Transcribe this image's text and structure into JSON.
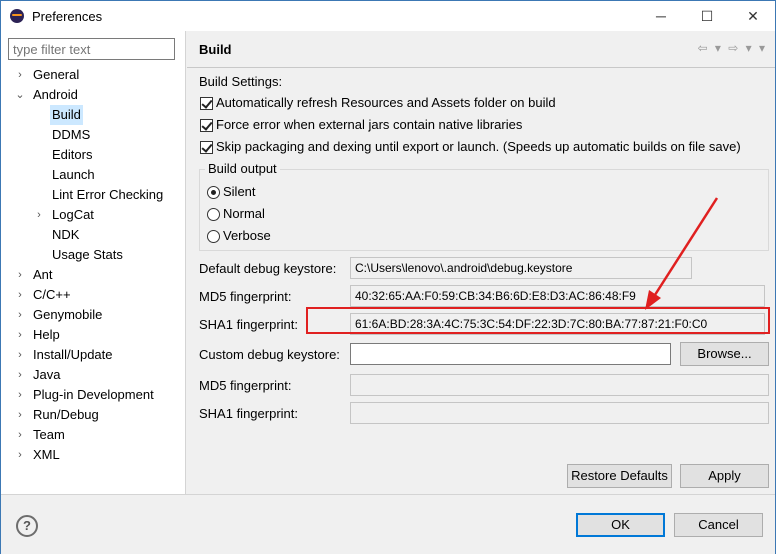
{
  "window": {
    "title": "Preferences",
    "minimize": "─",
    "maximize": "☐",
    "close": "✕"
  },
  "filter": {
    "placeholder": "type filter text"
  },
  "tree": [
    {
      "label": "General",
      "arrow": "›"
    },
    {
      "label": "Android",
      "arrow": "⌄"
    },
    {
      "label": "Build",
      "arrow": ""
    },
    {
      "label": "DDMS",
      "arrow": ""
    },
    {
      "label": "Editors",
      "arrow": ""
    },
    {
      "label": "Launch",
      "arrow": ""
    },
    {
      "label": "Lint Error Checking",
      "arrow": ""
    },
    {
      "label": "LogCat",
      "arrow": "›"
    },
    {
      "label": "NDK",
      "arrow": ""
    },
    {
      "label": "Usage Stats",
      "arrow": ""
    },
    {
      "label": "Ant",
      "arrow": "›"
    },
    {
      "label": "C/C++",
      "arrow": "›"
    },
    {
      "label": "Genymobile",
      "arrow": "›"
    },
    {
      "label": "Help",
      "arrow": "›"
    },
    {
      "label": "Install/Update",
      "arrow": "›"
    },
    {
      "label": "Java",
      "arrow": "›"
    },
    {
      "label": "Plug-in Development",
      "arrow": "›"
    },
    {
      "label": "Run/Debug",
      "arrow": "›"
    },
    {
      "label": "Team",
      "arrow": "›"
    },
    {
      "label": "XML",
      "arrow": "›"
    }
  ],
  "page": {
    "title": "Build",
    "nav_icons": "⇦ ▾ ⇨ ▾ ▾",
    "settings_label": "Build Settings:",
    "checks": [
      {
        "label": "Automatically refresh Resources and Assets folder on build",
        "checked": true
      },
      {
        "label": "Force error when external jars contain native libraries",
        "checked": true
      },
      {
        "label": "Skip packaging and dexing until export or launch. (Speeds up automatic builds on file save)",
        "checked": true
      }
    ],
    "build_output": {
      "title": "Build output",
      "options": [
        "Silent",
        "Normal",
        "Verbose"
      ],
      "selected": "Silent"
    },
    "default_keystore_label": "Default debug keystore:",
    "default_keystore_value": "C:\\Users\\lenovo\\.android\\debug.keystore",
    "md5_label": "MD5 fingerprint:",
    "md5_value": "40:32:65:AA:F0:59:CB:34:B6:6D:E8:D3:AC:86:48:F9",
    "sha1_label": "SHA1 fingerprint:",
    "sha1_value": "61:6A:BD:28:3A:4C:75:3C:54:DF:22:3D:7C:80:BA:77:87:21:F0:C0",
    "custom_keystore_label": "Custom debug keystore:",
    "custom_keystore_value": "",
    "custom_md5_label": "MD5 fingerprint:",
    "custom_sha1_label": "SHA1 fingerprint:",
    "browse_label": "Browse...",
    "restore_defaults_label": "Restore Defaults",
    "apply_label": "Apply"
  },
  "footer": {
    "help_symbol": "?",
    "ok_label": "OK",
    "cancel_label": "Cancel"
  },
  "colors": {
    "accent": "#0078d7",
    "annotation": "#e02020",
    "selection": "#cce8ff"
  }
}
